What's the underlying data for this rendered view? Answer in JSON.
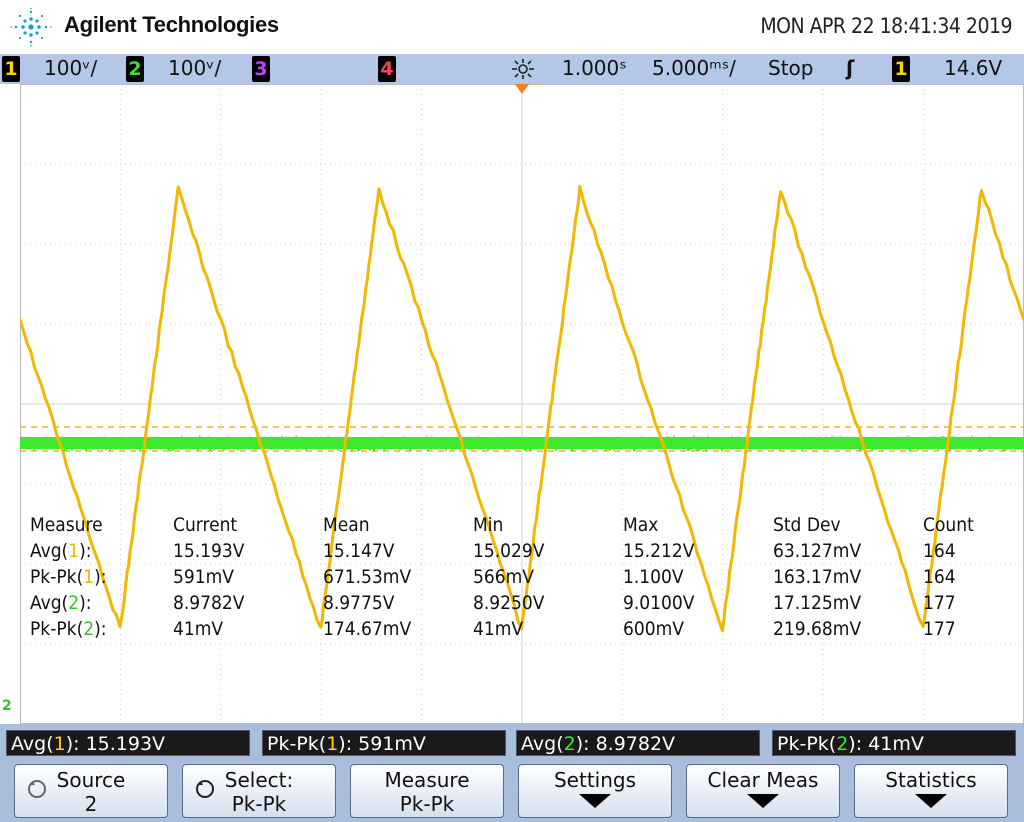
{
  "header": {
    "brand": "Agilent Technologies",
    "datetime": "MON APR 22 18:41:34 2019"
  },
  "status": {
    "ch1_num": "1",
    "ch1_scale": "100ᵛ/",
    "ch2_num": "2",
    "ch2_scale": "100ᵛ/",
    "ch3_num": "3",
    "ch4_num": "4",
    "time_delay": "1.000ˢ",
    "time_scale": "5.000ᵐˢ/",
    "run_state": "Stop",
    "trigger_slope": "ʃ",
    "trigger_source": "1",
    "trigger_level": "14.6V"
  },
  "measurements": {
    "headers": [
      "Measure",
      "Current",
      "Mean",
      "Min",
      "Max",
      "Std Dev",
      "Count"
    ],
    "rows": [
      {
        "name": "Avg(",
        "ch": "1",
        "close": "):",
        "current": "15.193V",
        "mean": "15.147V",
        "min": "15.029V",
        "max": "15.212V",
        "std": "63.127mV",
        "count": "164"
      },
      {
        "name": "Pk-Pk(",
        "ch": "1",
        "close": "):",
        "current": "591mV",
        "mean": "671.53mV",
        "min": "566mV",
        "max": "1.100V",
        "std": "163.17mV",
        "count": "164"
      },
      {
        "name": "Avg(",
        "ch": "2",
        "close": "):",
        "current": "8.9782V",
        "mean": "8.9775V",
        "min": "8.9250V",
        "max": "9.0100V",
        "std": "17.125mV",
        "count": "177"
      },
      {
        "name": "Pk-Pk(",
        "ch": "2",
        "close": "):",
        "current": "41mV",
        "mean": "174.67mV",
        "min": "41mV",
        "max": "600mV",
        "std": "219.68mV",
        "count": "177"
      }
    ]
  },
  "readouts": [
    {
      "name": "Avg(",
      "ch": "1",
      "close": "): ",
      "value": "15.193V"
    },
    {
      "name": "Pk-Pk(",
      "ch": "1",
      "close": "): ",
      "value": "591mV"
    },
    {
      "name": "Avg(",
      "ch": "2",
      "close": "): ",
      "value": "8.9782V"
    },
    {
      "name": "Pk-Pk(",
      "ch": "2",
      "close": "): ",
      "value": "41mV"
    }
  ],
  "softkeys": [
    {
      "line1": "Source",
      "line2": "2"
    },
    {
      "line1": "Select:",
      "line2": "Pk-Pk"
    },
    {
      "line1": "Measure",
      "line2": "Pk-Pk"
    },
    {
      "line1": "Settings",
      "line2": ""
    },
    {
      "line1": "Clear Meas",
      "line2": ""
    },
    {
      "line1": "Statistics",
      "line2": ""
    }
  ],
  "ground_marker": "2",
  "colors": {
    "ch1": "#f0b800",
    "ch2": "#3ee82c",
    "grid": "#d0d0d0",
    "statusbar": "#b4c7e8"
  },
  "waveforms": {
    "ch1": {
      "shape": "sawtooth",
      "period_divisions": 2.0,
      "peak_to_peak_divisions": 4.5
    },
    "ch2": {
      "shape": "flat-noise",
      "level_divisions_from_top": 4.5
    }
  }
}
